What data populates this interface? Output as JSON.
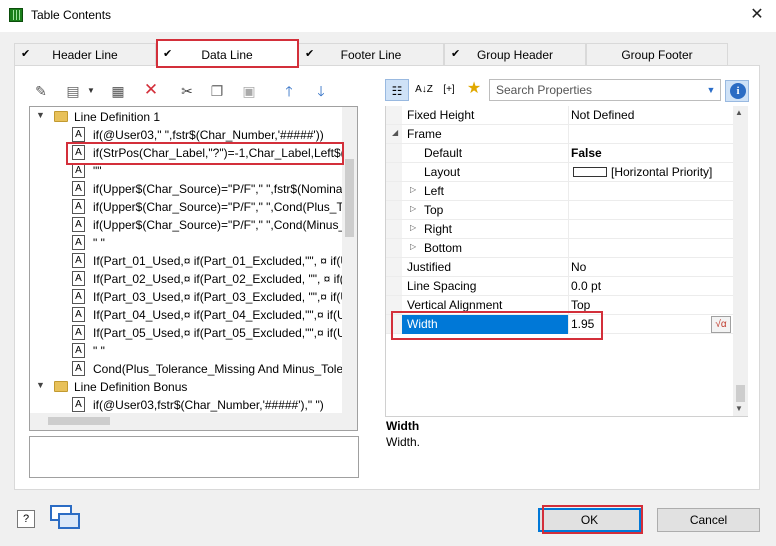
{
  "window": {
    "title": "Table Contents",
    "close_glyph": "✕"
  },
  "tabs": [
    {
      "label": "Header Line",
      "checked": true
    },
    {
      "label": "Data Line",
      "checked": true,
      "active": true
    },
    {
      "label": "Footer Line",
      "checked": true
    },
    {
      "label": "Group Header",
      "checked": true
    },
    {
      "label": "Group Footer",
      "checked": false
    }
  ],
  "left_toolbar": {
    "icons": [
      "wizard-icon",
      "new-item-icon",
      "properties-icon",
      "delete-icon",
      "cut-icon",
      "copy-icon",
      "paste-icon",
      "move-up-icon",
      "move-down-icon"
    ]
  },
  "tree": {
    "groups": [
      {
        "label": "Line Definition  1",
        "items": [
          "if(@User03,\" \",fstr$(Char_Number,'#####'))",
          "if(StrPos(Char_Label,\"?\")=-1,Char_Label,Left$(C",
          "\"\"",
          "if(Upper$(Char_Source)=\"P/F\",\" \",fstr$(Nomina",
          "if(Upper$(Char_Source)=\"P/F\",\" \",Cond(Plus_To",
          "if(Upper$(Char_Source)=\"P/F\",\" \",Cond(Minus_",
          "\" \"",
          "If(Part_01_Used,¤ if(Part_01_Excluded,\"\", ¤  if(Up",
          "If(Part_02_Used,¤ if(Part_02_Excluded, \"\", ¤  if(U",
          "If(Part_03_Used,¤ if(Part_03_Excluded, \"\",¤   if(U",
          "If(Part_04_Used,¤ if(Part_04_Excluded,\"\",¤   if(U",
          "If(Part_05_Used,¤ if(Part_05_Excluded,\"\",¤   if(Up",
          "\" \"",
          "Cond(Plus_Tolerance_Missing And Minus_Toler"
        ]
      },
      {
        "label": "Line Definition Bonus",
        "items": [
          "if(@User03,fstr$(Char_Number,'#####'),\" \")"
        ]
      }
    ],
    "selected_item": "if(StrPos(Char_Label,\"?\")=-1,Char_Label,Left$(C"
  },
  "properties_toolbar": {
    "categorized_icon": "categorized-icon",
    "sort_label": "A↓Z",
    "expand_label": "[+]",
    "favorites_icon": "star-icon",
    "search_placeholder": "Search Properties",
    "info_label": "i"
  },
  "properties": [
    {
      "name": "Fixed Height",
      "value": "Not Defined",
      "level": 0
    },
    {
      "name": "Frame",
      "value": "",
      "level": 0,
      "expanded": true
    },
    {
      "name": "Default",
      "value": "False",
      "level": 1,
      "bold_value": true
    },
    {
      "name": "Layout",
      "value": "[Horizontal Priority]",
      "level": 1,
      "swatch": true
    },
    {
      "name": "Left",
      "value": "",
      "level": 1,
      "collapsed": true
    },
    {
      "name": "Top",
      "value": "",
      "level": 1,
      "collapsed": true
    },
    {
      "name": "Right",
      "value": "",
      "level": 1,
      "collapsed": true
    },
    {
      "name": "Bottom",
      "value": "",
      "level": 1,
      "collapsed": true
    },
    {
      "name": "Justified",
      "value": "No",
      "level": 0
    },
    {
      "name": "Line Spacing",
      "value": "0.0 pt",
      "level": 0
    },
    {
      "name": "Vertical Alignment",
      "value": "Top",
      "level": 0
    },
    {
      "name": "Width",
      "value": "1.95",
      "level": 0,
      "selected": true,
      "formula": "√α"
    }
  ],
  "property_description": {
    "title": "Width",
    "text": "Width."
  },
  "buttons": {
    "ok": "OK",
    "cancel": "Cancel"
  },
  "colors": {
    "highlight": "#d32f3a",
    "selection": "#0078d7"
  }
}
